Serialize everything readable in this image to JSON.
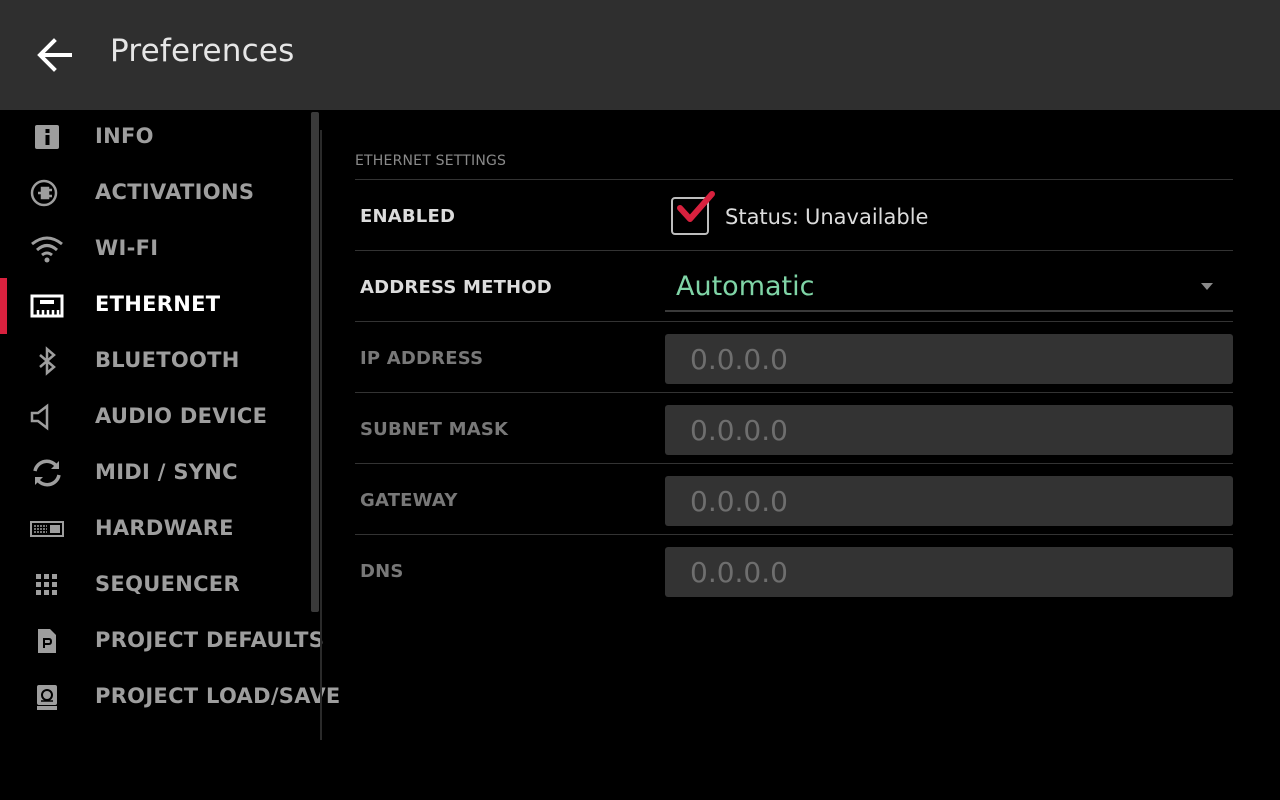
{
  "header": {
    "title": "Preferences",
    "back_icon": "arrow-left-icon"
  },
  "sidebar": {
    "items": [
      {
        "label": "INFO",
        "icon": "info-icon",
        "active": false
      },
      {
        "label": "ACTIVATIONS",
        "icon": "plug-icon",
        "active": false
      },
      {
        "label": "WI-FI",
        "icon": "wifi-icon",
        "active": false
      },
      {
        "label": "ETHERNET",
        "icon": "ethernet-icon",
        "active": true
      },
      {
        "label": "BLUETOOTH",
        "icon": "bluetooth-icon",
        "active": false
      },
      {
        "label": "AUDIO DEVICE",
        "icon": "speaker-icon",
        "active": false
      },
      {
        "label": "MIDI / SYNC",
        "icon": "sync-icon",
        "active": false
      },
      {
        "label": "HARDWARE",
        "icon": "hardware-icon",
        "active": false
      },
      {
        "label": "SEQUENCER",
        "icon": "grid-icon",
        "active": false
      },
      {
        "label": "PROJECT DEFAULTS",
        "icon": "document-icon",
        "active": false
      },
      {
        "label": "PROJECT LOAD/SAVE",
        "icon": "save-drive-icon",
        "active": false
      }
    ]
  },
  "ethernet": {
    "section_title": "ETHERNET SETTINGS",
    "enabled": {
      "label": "ENABLED",
      "checked": true,
      "status_label": "Status:",
      "status_value": "Unavailable"
    },
    "address_method": {
      "label": "ADDRESS METHOD",
      "value": "Automatic"
    },
    "fields": [
      {
        "label": "IP ADDRESS",
        "value": "0.0.0.0"
      },
      {
        "label": "SUBNET MASK",
        "value": "0.0.0.0"
      },
      {
        "label": "GATEWAY",
        "value": "0.0.0.0"
      },
      {
        "label": "DNS",
        "value": "0.0.0.0"
      }
    ]
  },
  "colors": {
    "accent": "#d8213e",
    "value_green": "#7fd4a6",
    "header_bg": "#2f2f2f",
    "field_bg": "#333333"
  }
}
